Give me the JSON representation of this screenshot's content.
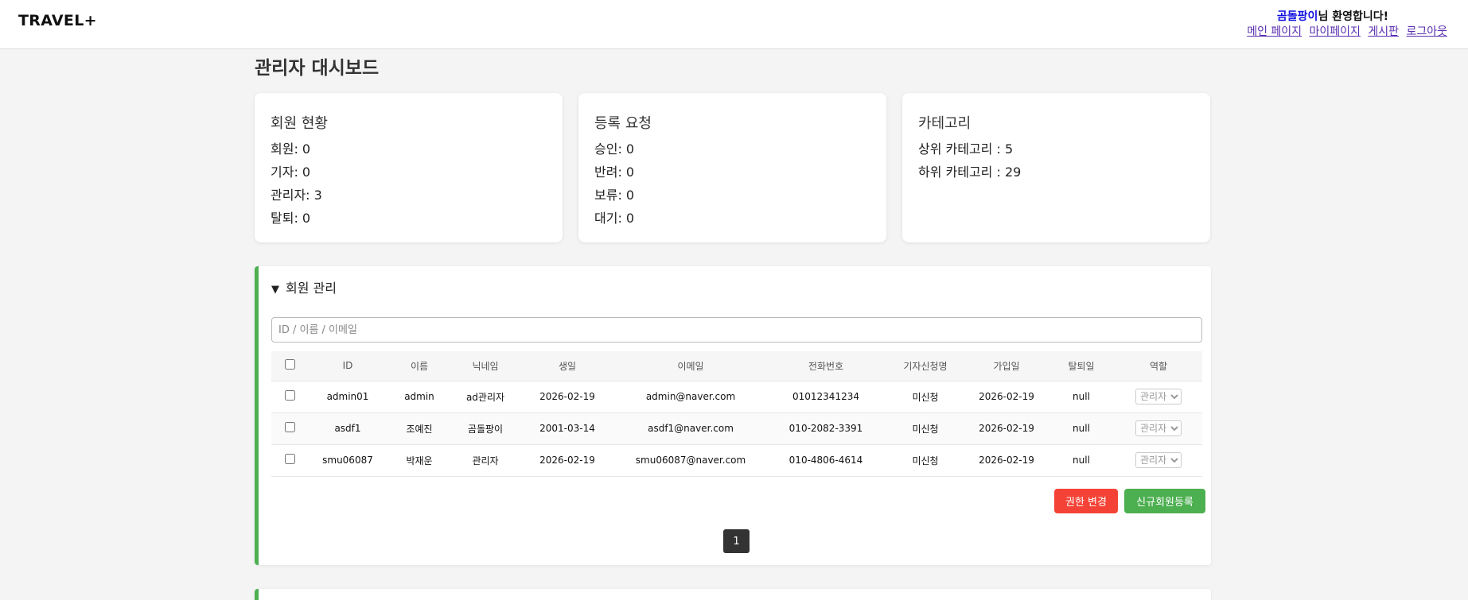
{
  "header": {
    "logo": "TRAVEL+",
    "welcome_name": "곰돌팡이",
    "welcome_suffix": "님 환영합니다!",
    "links": [
      "메인 페이지",
      "마이페이지",
      "게시판",
      "로그아웃"
    ]
  },
  "page_title": "관리자 대시보드",
  "cards": [
    {
      "title": "회원 현황",
      "stats": [
        "회원: 0",
        "기자: 0",
        "관리자: 3",
        "탈퇴: 0"
      ]
    },
    {
      "title": "등록 요청",
      "stats": [
        "승인: 0",
        "반려: 0",
        "보류: 0",
        "대기: 0"
      ]
    },
    {
      "title": "카테고리",
      "stats": [
        "상위 카테고리 : 5",
        "하위 카테고리 : 29"
      ]
    }
  ],
  "member_panel": {
    "arrow": "▼",
    "title": "회원 관리",
    "search_placeholder": "ID / 이름 / 이메일",
    "columns": [
      "ID",
      "이름",
      "닉네임",
      "생일",
      "이메일",
      "전화번호",
      "기자신청명",
      "가입일",
      "탈퇴일",
      "역할"
    ],
    "rows": [
      [
        "admin01",
        "admin",
        "ad관리자",
        "2026-02-19",
        "admin@naver.com",
        "01012341234",
        "미신청",
        "2026-02-19",
        "null",
        "관리자"
      ],
      [
        "asdf1",
        "조예진",
        "곰돌팡이",
        "2001-03-14",
        "asdf1@naver.com",
        "010-2082-3391",
        "미신청",
        "2026-02-19",
        "null",
        "관리자"
      ],
      [
        "smu06087",
        "박재운",
        "관리자",
        "2026-02-19",
        "smu06087@naver.com",
        "010-4806-4614",
        "미신청",
        "2026-02-19",
        "null",
        "관리자"
      ]
    ],
    "change_role_label": "권한 변경",
    "register_label": "신규회원등록",
    "current_page": "1"
  },
  "colors": {
    "accent_green": "#4caf50",
    "danger_red": "#f44336",
    "link_purple": "#5a2fb0",
    "name_blue": "#1010e0"
  }
}
